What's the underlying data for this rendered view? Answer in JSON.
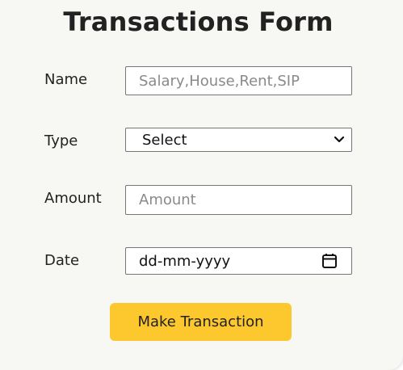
{
  "form": {
    "title": "Transactions Form",
    "name": {
      "label": "Name",
      "placeholder": "Salary,House,Rent,SIP",
      "value": ""
    },
    "type": {
      "label": "Type",
      "selected": "Select"
    },
    "amount": {
      "label": "Amount",
      "placeholder": "Amount",
      "value": ""
    },
    "date": {
      "label": "Date",
      "value": "dd-mm-yyyy"
    },
    "submit_label": "Make Transaction"
  },
  "icons": {
    "select_arrow": "chevron-down-icon",
    "date_picker": "calendar-icon"
  },
  "colors": {
    "button_bg": "#fdc72e",
    "card_bg": "#f7f7f3",
    "text": "#222222"
  }
}
